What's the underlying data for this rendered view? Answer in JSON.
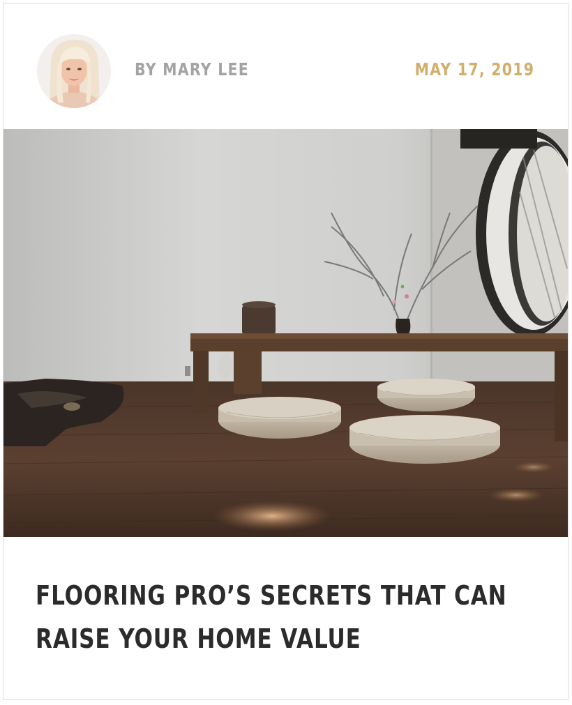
{
  "post": {
    "author": "BY MARY LEE",
    "date": "MAY 17, 2019",
    "title": "FLOORING PRO’S SECRETS THAT CAN RAISE YOUR HOME VALUE"
  },
  "colors": {
    "author": "#a3a3a3",
    "date": "#d2ae6d",
    "title": "#2b2b2b",
    "border": "#dcdcdc"
  }
}
